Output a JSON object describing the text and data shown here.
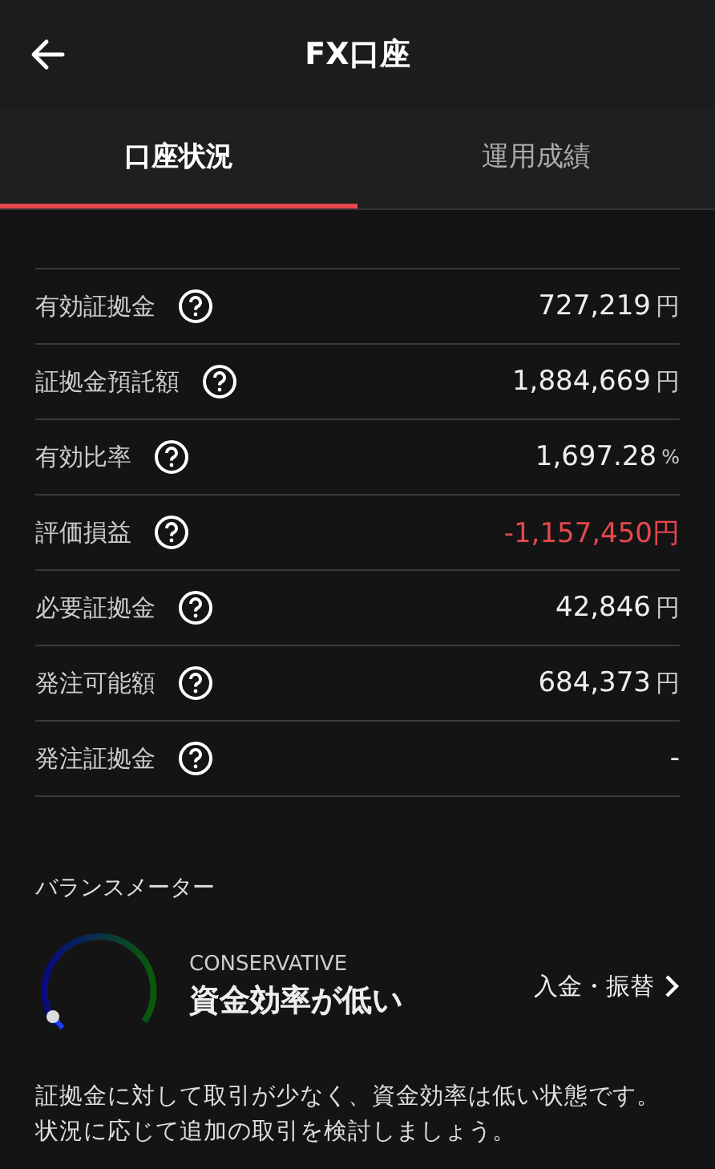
{
  "header": {
    "title": "FX口座"
  },
  "tabs": [
    {
      "label": "口座状況",
      "selected": true
    },
    {
      "label": "運用成績",
      "selected": false
    }
  ],
  "rows": [
    {
      "label": "有効証拠金",
      "value": "727,219",
      "unit": "円",
      "kind": "normal"
    },
    {
      "label": "証拠金預託額",
      "value": "1,884,669",
      "unit": "円",
      "kind": "normal"
    },
    {
      "label": "有効比率",
      "value": "1,697.28",
      "unit": "%",
      "kind": "normal"
    },
    {
      "label": "評価損益",
      "value": "-1,157,450円",
      "kind": "negative"
    },
    {
      "label": "必要証拠金",
      "value": "42,846",
      "unit": "円",
      "kind": "normal"
    },
    {
      "label": "発注可能額",
      "value": "684,373",
      "unit": "円",
      "kind": "normal"
    },
    {
      "label": "発注証拠金",
      "value": "-",
      "kind": "normal"
    }
  ],
  "balance_meter": {
    "title": "バランスメーター",
    "category": "CONSERVATIVE",
    "status": "資金効率が低い",
    "link": "入金・振替",
    "description": "証拠金に対して取引が少なく、資金効率は低い状態です。状況に応じて追加の取引を検討しましょう。"
  }
}
